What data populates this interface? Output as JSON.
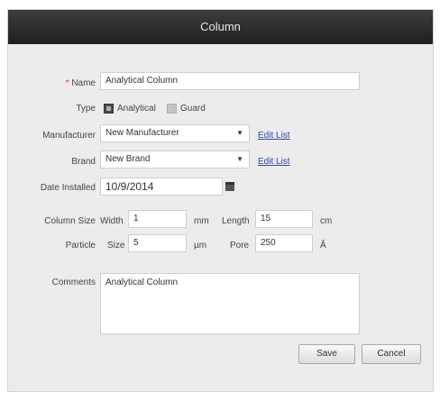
{
  "dialog": {
    "title": "Column"
  },
  "form": {
    "name": {
      "required_mark": "*",
      "label": "Name",
      "value": "Analytical Column"
    },
    "type": {
      "label": "Type",
      "options": [
        {
          "label": "Analytical",
          "checked": true
        },
        {
          "label": "Guard",
          "checked": false
        }
      ]
    },
    "manufacturer": {
      "label": "Manufacturer",
      "value": "New Manufacturer",
      "edit_link": "Edit List"
    },
    "brand": {
      "label": "Brand",
      "value": "New Brand",
      "edit_link": "Edit List"
    },
    "date_installed": {
      "label": "Date Installed",
      "value": "10/9/2014"
    },
    "column_size": {
      "label": "Column Size",
      "width_label": "Width",
      "width_value": "1",
      "width_unit": "mm",
      "length_label": "Length",
      "length_value": "15",
      "length_unit": "cm"
    },
    "particle": {
      "label": "Particle",
      "size_label": "Size",
      "size_value": "5",
      "size_unit": "µm",
      "pore_label": "Pore",
      "pore_value": "250",
      "pore_unit": "Å"
    },
    "comments": {
      "label": "Comments",
      "value": "Analytical Column"
    }
  },
  "buttons": {
    "save": "Save",
    "cancel": "Cancel"
  },
  "icons": {
    "dropdown": "chevron-down-icon",
    "calendar": "calendar-icon"
  }
}
